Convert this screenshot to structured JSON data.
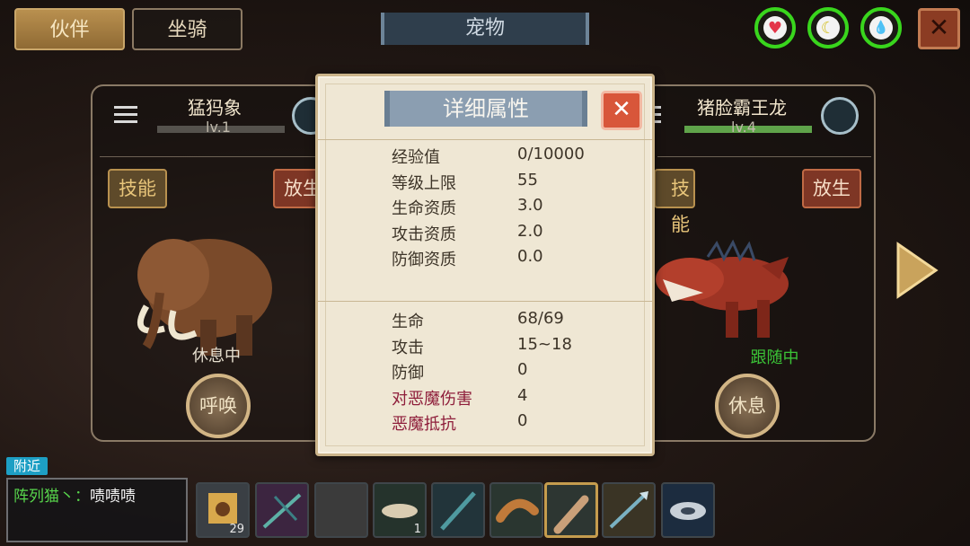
{
  "top": {
    "tab_companion": "伙伴",
    "tab_mount": "坐骑",
    "page_title": "宠物",
    "close_glyph": "✕"
  },
  "status_icons": [
    {
      "name": "heart-icon",
      "glyph": "♥",
      "color": "#e3364a"
    },
    {
      "name": "banana-icon",
      "glyph": "☾",
      "color": "#e8d335"
    },
    {
      "name": "water-drop-icon",
      "glyph": "💧",
      "color": "#43b6e0"
    }
  ],
  "left_pet": {
    "name": "猛犸象",
    "level": "lv.1",
    "level_fraction": 0.0,
    "skill_label": "技能",
    "release_label": "放生",
    "status": "休息中",
    "action_label": "呼唤"
  },
  "right_pet": {
    "name": "猪脸霸王龙",
    "level": "lv.4",
    "level_fraction": 1.0,
    "skill_label": "技能",
    "release_label": "放生",
    "status": "跟随中",
    "action_label": "休息"
  },
  "modal": {
    "title": "详细属性",
    "close_glyph": "✕",
    "section1": [
      {
        "key": "经验值",
        "value": "0/10000"
      },
      {
        "key": "等级上限",
        "value": "55"
      },
      {
        "key": "生命资质",
        "value": "3.0"
      },
      {
        "key": "攻击资质",
        "value": "2.0"
      },
      {
        "key": "防御资质",
        "value": "0.0"
      }
    ],
    "section2": [
      {
        "key": "生命",
        "value": "68/69"
      },
      {
        "key": "攻击",
        "value": "15~18"
      },
      {
        "key": "防御",
        "value": "0"
      },
      {
        "key": "对恶魔伤害",
        "value": "4",
        "highlight": true
      },
      {
        "key": "恶魔抵抗",
        "value": "0",
        "highlight": true
      }
    ]
  },
  "chat": {
    "channel": "附近",
    "sender": "阵列猫丶：",
    "message": "啧啧啧"
  },
  "hotbar": [
    {
      "name": "slot-seed-bag",
      "count": "29"
    },
    {
      "name": "slot-crossbow",
      "count": ""
    },
    {
      "name": "slot-empty",
      "count": ""
    },
    {
      "name": "slot-bone-item",
      "count": "1"
    },
    {
      "name": "slot-staff",
      "count": ""
    },
    {
      "name": "slot-sausage",
      "count": ""
    },
    {
      "name": "slot-club",
      "count": ""
    },
    {
      "name": "slot-spear",
      "count": ""
    },
    {
      "name": "slot-disc",
      "count": ""
    }
  ]
}
